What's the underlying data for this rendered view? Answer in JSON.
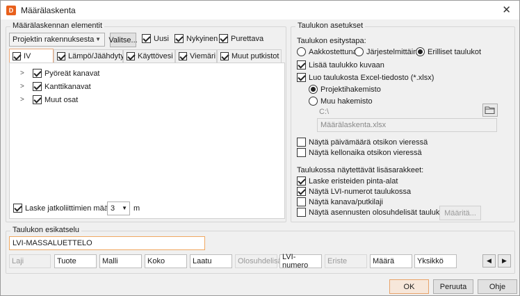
{
  "window": {
    "title": "Määrälaskenta",
    "app_icon_letter": "D",
    "close_glyph": "✕"
  },
  "elements_group": {
    "label": "Määrälaskennan elementit",
    "source_select": {
      "value": "Projektin rakennuksesta"
    },
    "select_button": "Valitse...",
    "filters": [
      {
        "label": "Uusi",
        "checked": true
      },
      {
        "label": "Nykyinen",
        "checked": true
      },
      {
        "label": "Purettava",
        "checked": true
      }
    ],
    "tabs": [
      {
        "label": "IV",
        "checked": true,
        "active": true
      },
      {
        "label": "Lämpö/Jäähdytys",
        "checked": true,
        "active": false
      },
      {
        "label": "Käyttövesi",
        "checked": true,
        "active": false
      },
      {
        "label": "Viemäri",
        "checked": true,
        "active": false
      },
      {
        "label": "Muut putkistot",
        "checked": true,
        "active": false
      }
    ],
    "tree": [
      {
        "label": "Pyöreät kanavat",
        "checked": true
      },
      {
        "label": "Kanttikanavat",
        "checked": true
      },
      {
        "label": "Muut osat",
        "checked": true
      }
    ],
    "fittings": {
      "label": "Laske jatkoliittimien määrä",
      "checked": true,
      "value": "3",
      "unit": "m"
    }
  },
  "table_settings": {
    "label": "Taulukon asetukset",
    "presentation_label": "Taulukon esitystapa:",
    "presentation_options": [
      {
        "label": "Aakkostettuna",
        "selected": false
      },
      {
        "label": "Järjestelmittäin",
        "selected": false
      },
      {
        "label": "Erilliset taulukot",
        "selected": true
      }
    ],
    "add_to_drawing": {
      "label": "Lisää taulukko kuvaan",
      "checked": true
    },
    "excel": {
      "label": "Luo taulukosta Excel-tiedosto (*.xlsx)",
      "checked": true
    },
    "dir_options": [
      {
        "label": "Projektihakemisto",
        "selected": true
      },
      {
        "label": "Muu hakemisto",
        "selected": false
      }
    ],
    "path_value": "C:\\",
    "filename_value": "Määrälaskenta.xlsx",
    "show_date": {
      "label": "Näytä päivämäärä otsikon vieressä",
      "checked": false
    },
    "show_time": {
      "label": "Näytä kellonaika otsikon vieressä",
      "checked": false
    },
    "extra_label": "Taulukossa näytettävät lisäsarakkeet:",
    "extras": [
      {
        "label": "Laske eristeiden pinta-alat",
        "checked": true
      },
      {
        "label": "Näytä LVI-numerot taulukossa",
        "checked": true
      },
      {
        "label": "Näytä kanava/putkilaji",
        "checked": false
      },
      {
        "label": "Näytä asennusten olosuhdelisät taulukossa",
        "checked": false
      }
    ],
    "define_button": "Määritä..."
  },
  "preview": {
    "label": "Taulukon esikatselu",
    "title_value": "LVI-MASSALUETTELO",
    "columns": [
      {
        "label": "Laji",
        "enabled": false
      },
      {
        "label": "Tuote",
        "enabled": true
      },
      {
        "label": "Malli",
        "enabled": true
      },
      {
        "label": "Koko",
        "enabled": true
      },
      {
        "label": "Laatu",
        "enabled": true
      },
      {
        "label": "Olosuhdelisä",
        "enabled": false
      },
      {
        "label": "LVI-numero",
        "enabled": true
      },
      {
        "label": "Eriste",
        "enabled": false
      },
      {
        "label": "Määrä",
        "enabled": true
      },
      {
        "label": "Yksikkö",
        "enabled": true
      }
    ],
    "nav_prev": "◀",
    "nav_next": "▶"
  },
  "footer": {
    "ok": "OK",
    "cancel": "Peruuta",
    "help": "Ohje"
  },
  "colors": {
    "accent": "#e8601c",
    "focus_border": "#e8a36a"
  }
}
